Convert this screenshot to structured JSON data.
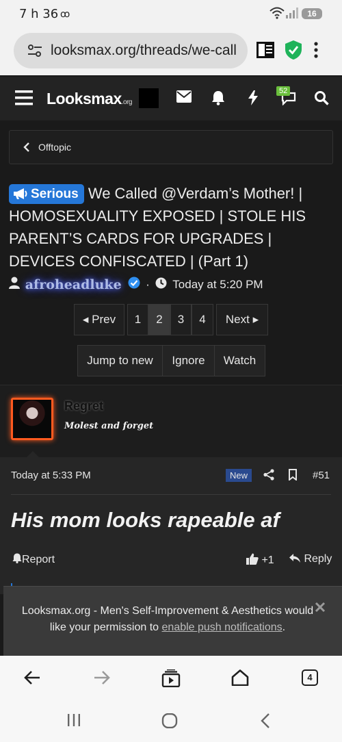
{
  "status_bar": {
    "time": "7 h 36",
    "voicemail": "ꝏ",
    "battery": "16"
  },
  "browser": {
    "url": "looksmax.org/threads/we-call",
    "tab_count": "4"
  },
  "site": {
    "logo_main": "Looksmax",
    "logo_tld": ".org",
    "alerts_count": "52"
  },
  "breadcrumb": {
    "label": "Offtopic"
  },
  "thread": {
    "prefix": "Serious",
    "title": "We Called @Verdam’s Mother! | HOMOSEXUALITY EXPOSED | STOLE HIS PARENT’S CARDS FOR UPGRADES | DEVICES CONFISCATED | (Part 1)",
    "author": "afroheadluke",
    "separator": "·",
    "posted": "Today at 5:20 PM"
  },
  "pagination": {
    "prev": "◂ Prev",
    "pages": [
      "1",
      "2",
      "3",
      "4"
    ],
    "current": "2",
    "next": "Next ▸"
  },
  "thread_actions": {
    "jump": "Jump to new",
    "ignore": "Ignore",
    "watch": "Watch"
  },
  "post": {
    "username": "Regret",
    "user_title": "Molest and forget",
    "date": "Today at 5:33 PM",
    "new_label": "New",
    "number": "#51",
    "message": "His mom looks rapeable af",
    "report": "Report",
    "likes": "+1",
    "reply": "Reply"
  },
  "notification": {
    "text": "Looksmax.org - Men's Self-Improvement & Aesthetics would like your permission to",
    "link": "enable push notifications",
    "end": "."
  },
  "colors": {
    "prefix_blue": "#2577d8",
    "avatar_border": "#ff5a1f",
    "alerts_green": "#6abf3c"
  }
}
